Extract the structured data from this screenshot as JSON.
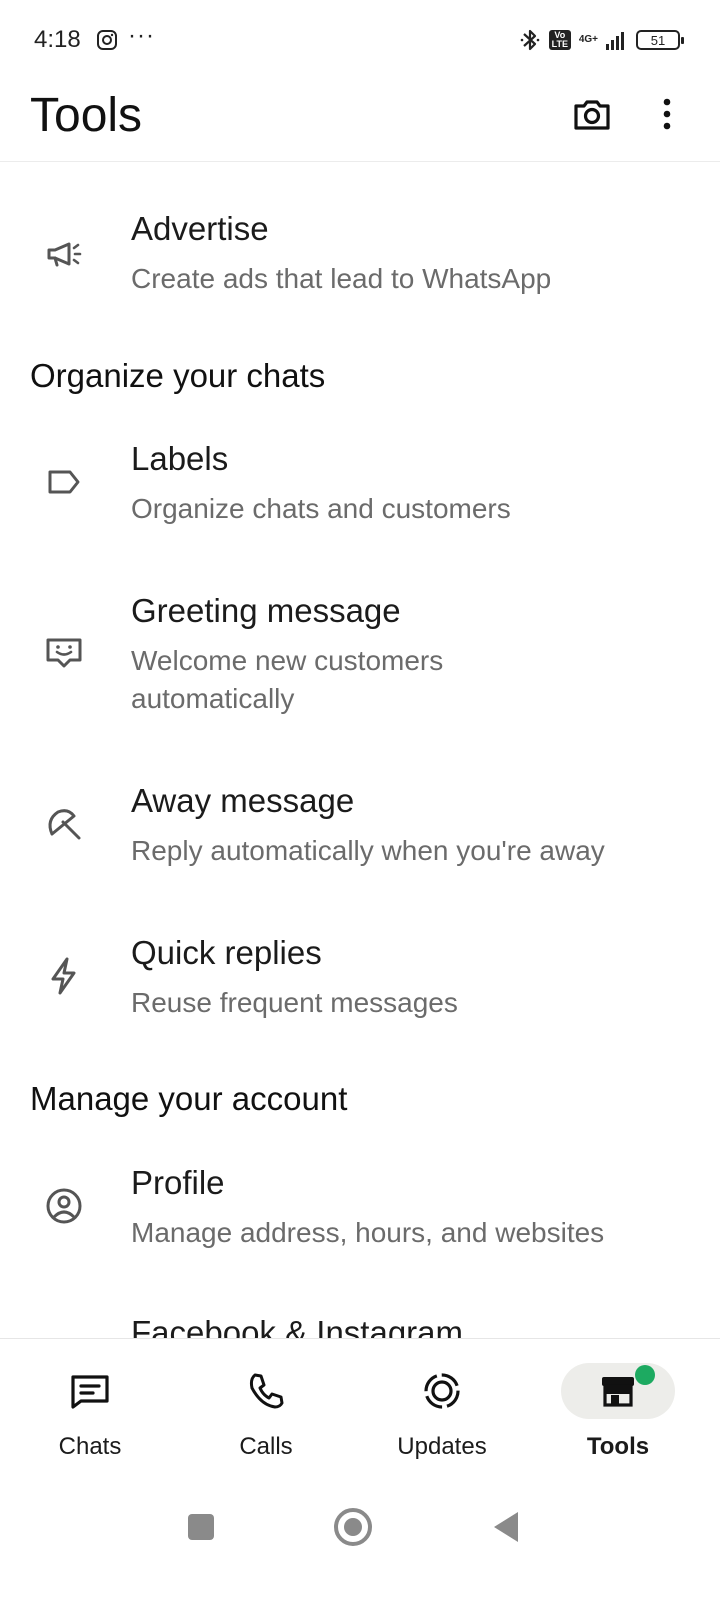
{
  "status_bar": {
    "time": "4:18",
    "dots": "···",
    "volte": "Vo LTE",
    "network": "4G+",
    "battery": "51"
  },
  "app_bar": {
    "title": "Tools"
  },
  "items": [
    {
      "title": "Advertise",
      "subtitle": "Create ads that lead to WhatsApp",
      "icon": "megaphone-icon"
    },
    {
      "title": "Labels",
      "subtitle": "Organize chats and customers",
      "icon": "label-icon"
    },
    {
      "title": "Greeting message",
      "subtitle": "Welcome new customers automatically",
      "icon": "greeting-icon"
    },
    {
      "title": "Away message",
      "subtitle": "Reply automatically when you're away",
      "icon": "away-icon"
    },
    {
      "title": "Quick replies",
      "subtitle": "Reuse frequent messages",
      "icon": "lightning-icon"
    },
    {
      "title": "Profile",
      "subtitle": "Manage address, hours, and websites",
      "icon": "profile-icon"
    },
    {
      "title": "Facebook & Instagram",
      "subtitle": "",
      "icon": ""
    }
  ],
  "sections": {
    "organize": "Organize your chats",
    "manage": "Manage your account"
  },
  "bottom_nav": {
    "tabs": [
      {
        "label": "Chats",
        "icon": "chats-icon"
      },
      {
        "label": "Calls",
        "icon": "phone-icon"
      },
      {
        "label": "Updates",
        "icon": "updates-icon"
      },
      {
        "label": "Tools",
        "icon": "store-icon",
        "active": true
      }
    ],
    "badge_color": "#1daa61"
  }
}
